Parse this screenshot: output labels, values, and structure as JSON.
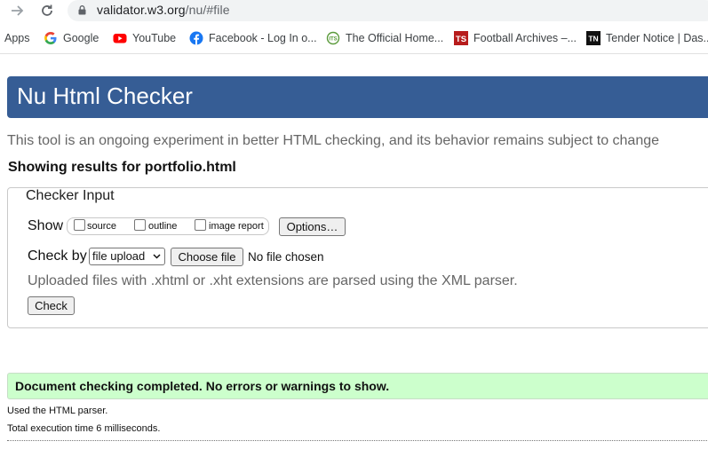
{
  "browser": {
    "url_host": "validator.w3.org",
    "url_path": "/nu/#file",
    "bookmarks": [
      {
        "label": "Apps",
        "icon": "apps-icon"
      },
      {
        "label": "Google",
        "icon": "google-icon"
      },
      {
        "label": "YouTube",
        "icon": "youtube-icon"
      },
      {
        "label": "Facebook - Log In o...",
        "icon": "facebook-icon"
      },
      {
        "label": "The Official Home...",
        "icon": "site-icon"
      },
      {
        "label": "Football Archives –...",
        "icon": "ts-icon"
      },
      {
        "label": "Tender Notice | Das...",
        "icon": "tn-icon"
      }
    ]
  },
  "page": {
    "title": "Nu Html Checker",
    "subtitle": "This tool is an ongoing experiment in better HTML checking, and its behavior remains subject to change",
    "showing_results": "Showing results for portfolio.html",
    "checker_input": {
      "legend": "Checker Input",
      "show_label": "Show",
      "options": [
        {
          "label": "source",
          "checked": false
        },
        {
          "label": "outline",
          "checked": false
        },
        {
          "label": "image report",
          "checked": false
        }
      ],
      "options_button": "Options…",
      "check_by_label": "Check by",
      "check_by_value": "file upload",
      "choose_file_button": "Choose file",
      "no_file_text": "No file chosen",
      "hint": "Uploaded files with .xhtml or .xht extensions are parsed using the XML parser.",
      "check_button": "Check"
    },
    "result_message": "Document checking completed. No errors or warnings to show.",
    "parser_info": "Used the HTML parser.",
    "time_info": "Total execution time 6 milliseconds."
  },
  "colors": {
    "title_bar": "#365d95",
    "success_bg": "#ccffcc"
  }
}
